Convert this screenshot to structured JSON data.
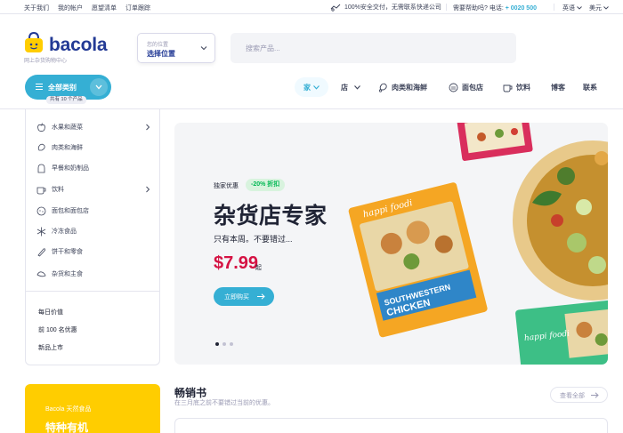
{
  "topbar": {
    "links": [
      "关于我们",
      "我的帐户",
      "愿望清单",
      "订单跟踪"
    ],
    "notice": "100%安全交付，无需联系快递公司",
    "help_label": "需要帮助吗? 电话:",
    "phone": "+ 0020 500",
    "language": "英语",
    "currency": "美元"
  },
  "header": {
    "logo_name": "bacola",
    "logo_tagline": "网上杂货购物中心",
    "location_label": "您的位置",
    "location_value": "选择位置",
    "search_placeholder": "搜索产品..."
  },
  "nav": {
    "all_categories": "全部类别",
    "product_count": "共有 10 个产品",
    "items": [
      {
        "label": "家",
        "active": true
      },
      {
        "label": "店"
      },
      {
        "label": "肉类和海鲜",
        "icon": "meat-icon"
      },
      {
        "label": "面包店",
        "icon": "bakery-icon"
      },
      {
        "label": "饮料",
        "icon": "cup-icon"
      },
      {
        "label": "博客"
      },
      {
        "label": "联系"
      }
    ]
  },
  "sidebar": {
    "categories": [
      {
        "label": "水果和蔬菜",
        "icon": "apple-icon",
        "has_sub": true
      },
      {
        "label": "肉类和海鲜",
        "icon": "meat-icon"
      },
      {
        "label": "早餐和奶制品",
        "icon": "breakfast-icon"
      },
      {
        "label": "饮料",
        "icon": "cup-icon",
        "has_sub": true
      },
      {
        "label": "面包和面包店",
        "icon": "bread-icon"
      },
      {
        "label": "冷冻食品",
        "icon": "snowflake-icon"
      },
      {
        "label": "饼干和零食",
        "icon": "cookie-icon"
      },
      {
        "label": "杂货和主食",
        "icon": "grocery-icon"
      }
    ],
    "extra_links": [
      "每日价值",
      "前 100 名优惠",
      "新品上市"
    ]
  },
  "hero": {
    "kicker": "独家优惠",
    "discount_badge": "-20% 折扣",
    "title": "杂货店专家",
    "subtitle": "只有本周。不要错过...",
    "price": "$7.99",
    "price_suffix": "起",
    "button_label": "立即购买",
    "slide_count": 3,
    "active_slide": 1
  },
  "promo": {
    "kicker": "Bacola 天然食品",
    "title": "特种有机"
  },
  "bestsellers": {
    "title": "畅销书",
    "subtitle": "在三月底之前不要错过当前的优惠。",
    "view_all": "查看全部"
  },
  "colors": {
    "brand_blue": "#233a95",
    "accent": "#35afd4",
    "price_red": "#d51243",
    "discount_green": "#00b853",
    "promo_yellow": "#ffcd00"
  }
}
